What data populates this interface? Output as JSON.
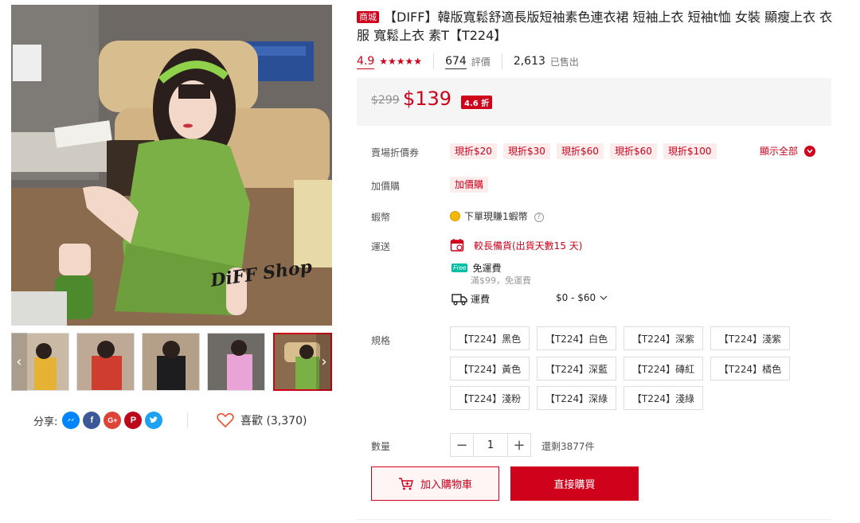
{
  "product": {
    "mall_badge": "商城",
    "title": "【DIFF】韓版寬鬆舒適長版短袖素色連衣裙 短袖上衣 短袖t恤 女裝 顯瘦上衣 衣服 寬鬆上衣 素T【T224】",
    "watermark": "DiFF Shop"
  },
  "rating": {
    "score": "4.9",
    "stars": "★★★★★",
    "reviews_count": "674",
    "reviews_label": "評價",
    "sold_count": "2,613",
    "sold_label": "已售出"
  },
  "price": {
    "original": "$299",
    "current": "$139",
    "discount": "4.6 折"
  },
  "vouchers": {
    "label": "賣場折價券",
    "items": [
      "現折$20",
      "現折$30",
      "現折$60",
      "現折$60",
      "現折$100"
    ],
    "show_all": "顯示全部"
  },
  "addon": {
    "label": "加價購",
    "tag": "加價購"
  },
  "coins": {
    "label": "蝦幣",
    "text": "下單現賺1蝦幣"
  },
  "shipping": {
    "label": "運送",
    "preorder": "較長備貨(出貨天數15 天)",
    "free_badge": "Free",
    "free_title": "免運費",
    "free_condition": "滿$99，免運費",
    "fee_label": "運費",
    "fee_range": "$0 - $60"
  },
  "variations": {
    "label": "規格",
    "options": [
      "【T224】黑色",
      "【T224】白色",
      "【T224】深紫",
      "【T224】淺紫",
      "【T224】黃色",
      "【T224】深藍",
      "【T224】磚紅",
      "【T224】橘色",
      "【T224】淺粉",
      "【T224】深綠",
      "【T224】淺綠"
    ]
  },
  "quantity": {
    "label": "數量",
    "minus": "−",
    "value": "1",
    "plus": "+",
    "stock": "還剩3877件"
  },
  "actions": {
    "add_to_cart": "加入購物車",
    "buy_now": "直接購買"
  },
  "share": {
    "label": "分享:",
    "icons": [
      "messenger-icon",
      "facebook-icon",
      "google-plus-icon",
      "pinterest-icon",
      "twitter-icon"
    ]
  },
  "favorite": {
    "label": "喜歡 (3,370)"
  },
  "colors": {
    "brand_red": "#d0011b",
    "price_bg": "#f5f5f5"
  }
}
